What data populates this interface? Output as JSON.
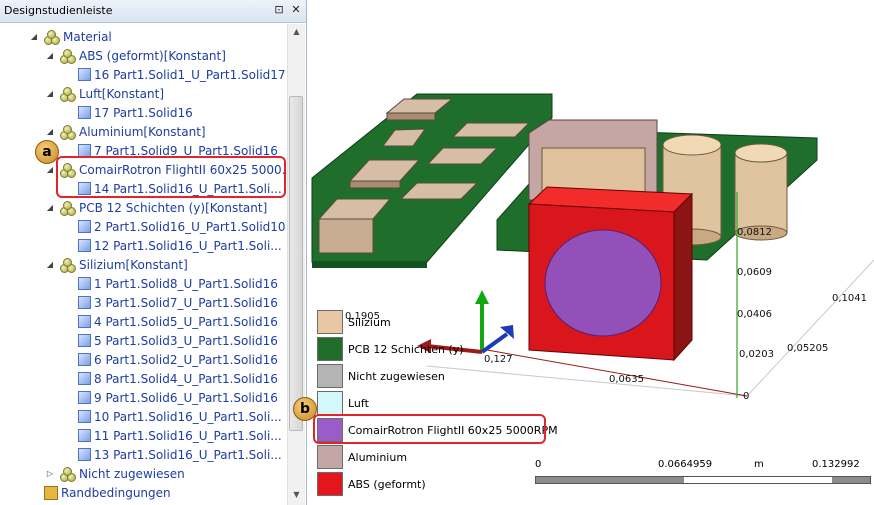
{
  "panel": {
    "title": "Designstudienleiste",
    "pin_glyph": "⊡",
    "close_glyph": "✕"
  },
  "tree": {
    "material_label": "Material",
    "groups": [
      {
        "label": "ABS (geformt)[Konstant]",
        "solids": [
          "16 Part1.Solid1_U_Part1.Solid17"
        ]
      },
      {
        "label": "Luft[Konstant]",
        "solids": [
          "17 Part1.Solid16"
        ]
      },
      {
        "label": "Aluminium[Konstant]",
        "solids": [
          "7 Part1.Solid9_U_Part1.Solid16"
        ]
      },
      {
        "label": "ComairRotron FlightII 60x25 5000...",
        "solids": [
          "14 Part1.Solid16_U_Part1.Soli..."
        ]
      },
      {
        "label": "PCB 12 Schichten (y)[Konstant]",
        "solids": [
          "2 Part1.Solid16_U_Part1.Solid10",
          "12 Part1.Solid16_U_Part1.Soli..."
        ]
      },
      {
        "label": "Silizium[Konstant]",
        "solids": [
          "1 Part1.Solid8_U_Part1.Solid16",
          "3 Part1.Solid7_U_Part1.Solid16",
          "4 Part1.Solid5_U_Part1.Solid16",
          "5 Part1.Solid3_U_Part1.Solid16",
          "6 Part1.Solid2_U_Part1.Solid16",
          "8 Part1.Solid4_U_Part1.Solid16",
          "9 Part1.Solid6_U_Part1.Solid16",
          "10 Part1.Solid16_U_Part1.Soli...",
          "11 Part1.Solid16_U_Part1.Soli...",
          "13 Part1.Solid16_U_Part1.Soli..."
        ]
      }
    ],
    "unassigned_label": "Nicht zugewiesen",
    "boundary_label": "Randbedingungen"
  },
  "callouts": {
    "a": "a",
    "b": "b"
  },
  "legend": [
    {
      "label": "Silizium",
      "color": "#e8c8a4"
    },
    {
      "label": "PCB 12 Schichten (y)",
      "color": "#1f6e2c"
    },
    {
      "label": "Nicht zugewiesen",
      "color": "#b4b4b4"
    },
    {
      "label": "Luft",
      "color": "#d4f7fb"
    },
    {
      "label": "ComairRotron FlightII 60x25 5000RPM",
      "color": "#9a5cc7"
    },
    {
      "label": "Aluminium",
      "color": "#c3a6a6"
    },
    {
      "label": "ABS (geformt)",
      "color": "#e3161e"
    }
  ],
  "axis_labels": {
    "v1": "0,0812",
    "v2": "0,0609",
    "v3": "0,0406",
    "v4": "0,0203",
    "d1": "0,1041",
    "d2": "0,05205",
    "h1": "0,0635",
    "zero": "0",
    "l1": "0,1905",
    "l2": "0,127"
  },
  "scale": {
    "start": "0",
    "mid": "0.0664959",
    "unit": "m",
    "end": "0.132992"
  }
}
